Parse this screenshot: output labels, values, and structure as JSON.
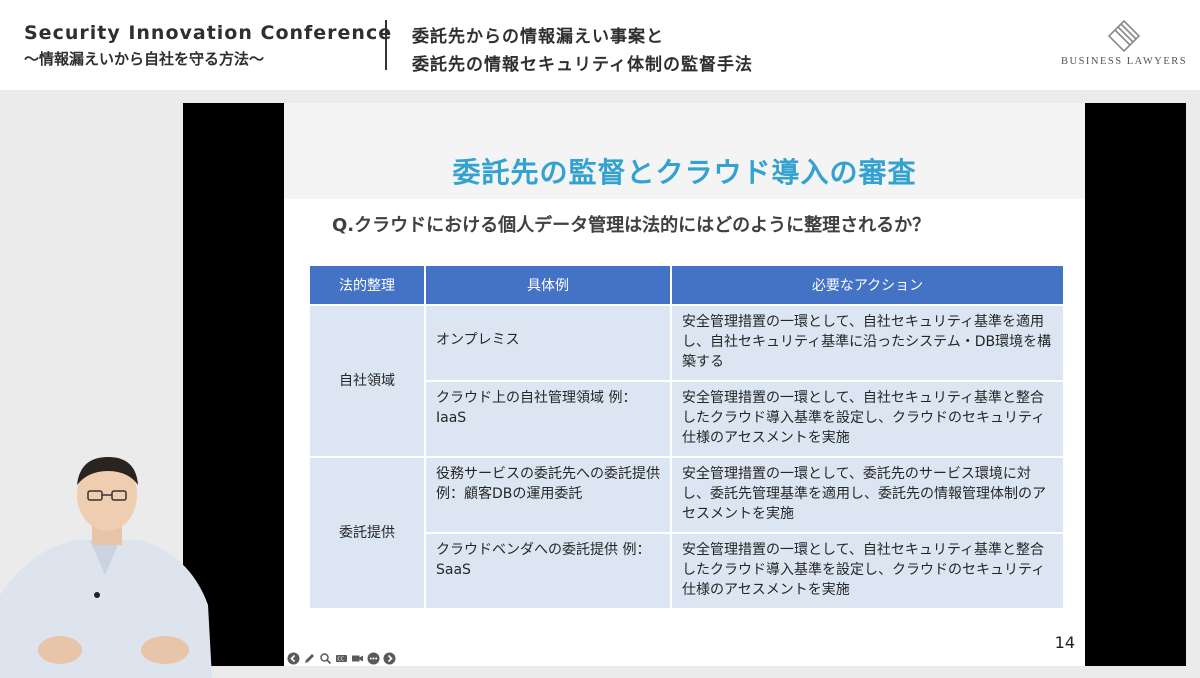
{
  "header": {
    "conference_title": "Security Innovation Conference",
    "conference_subtitle": "〜情報漏えいから自社を守る方法〜",
    "talk_title_line1": "委託先からの情報漏えい事案と",
    "talk_title_line2": "委託先の情報セキュリティ体制の監督手法",
    "logo_text": "BUSINESS LAWYERS"
  },
  "slide": {
    "title": "委託先の監督とクラウド導入の審査",
    "question": "Q.クラウドにおける個人データ管理は法的にはどのように整理されるか？",
    "page_number": "14",
    "table": {
      "headers": [
        "法的整理",
        "具体例",
        "必要なアクション"
      ],
      "groups": [
        {
          "category": "自社領域",
          "rows": [
            {
              "example": "オンプレミス",
              "action": "安全管理措置の一環として、自社セキュリティ基準を適用し、自社セキュリティ基準に沿ったシステム・DB環境を構築する"
            },
            {
              "example": "クラウド上の自社管理領域 例：IaaS",
              "action": "安全管理措置の一環として、自社セキュリティ基準と整合したクラウド導入基準を設定し、クラウドのセキュリティ仕様のアセスメントを実施"
            }
          ]
        },
        {
          "category": "委託提供",
          "rows": [
            {
              "example": "役務サービスの委託先への委託提供 例：顧客DBの運用委託",
              "action": "安全管理措置の一環として、委託先のサービス環境に対し、委託先管理基準を適用し、委託先の情報管理体制のアセスメントを実施"
            },
            {
              "example": "クラウドベンダへの委託提供 例：SaaS",
              "action": "安全管理措置の一環として、自社セキュリティ基準と整合したクラウド導入基準を設定し、クラウドのセキュリティ仕様のアセスメントを実施"
            }
          ]
        }
      ]
    }
  },
  "player_toolbar": {
    "icons": [
      "back-icon",
      "pen-icon",
      "zoom-icon",
      "captions-icon",
      "camera-icon",
      "more-icon",
      "forward-icon"
    ]
  },
  "colors": {
    "title_blue": "#33a2d1",
    "table_header_blue": "#4472c4",
    "table_cell_blue": "#dce6f3"
  }
}
